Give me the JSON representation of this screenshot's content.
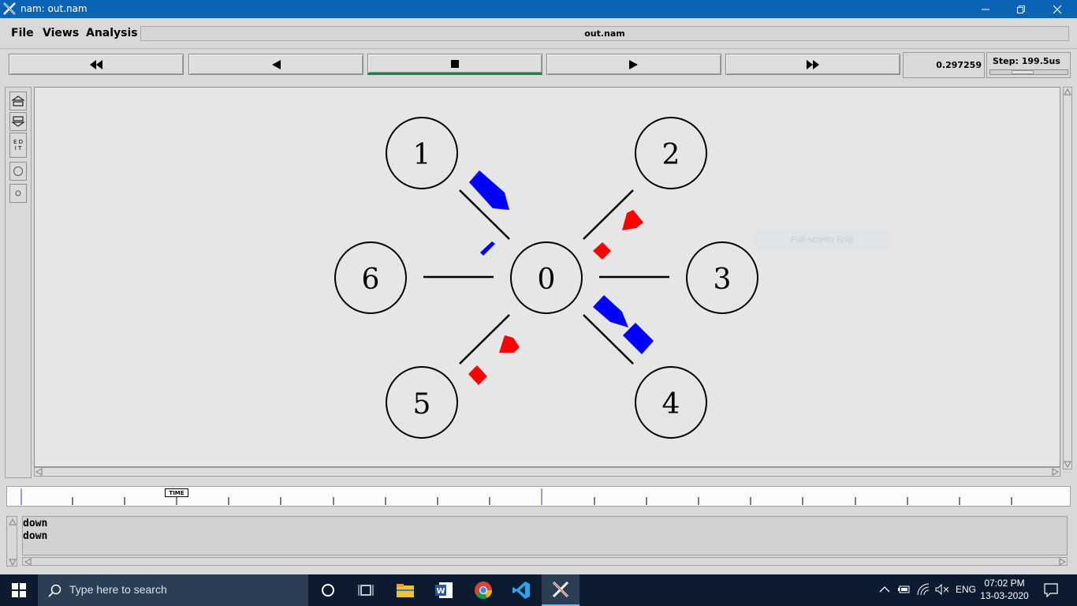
{
  "window": {
    "title": "nam: out.nam"
  },
  "menu": {
    "file": "File",
    "views": "Views",
    "analysis": "Analysis"
  },
  "filename": "out.nam",
  "controls": {
    "buttons": [
      "rewind",
      "step-back",
      "stop",
      "play",
      "fast-forward"
    ],
    "active": "stop"
  },
  "time": {
    "value": "0.297259",
    "step_label": "Step: 199.5us"
  },
  "tools": [
    "zoom-in-icon",
    "zoom-out-icon",
    "EDIT",
    "node-circle-icon",
    "small-node-icon"
  ],
  "topology": {
    "nodes": [
      {
        "id": "0",
        "label": "0"
      },
      {
        "id": "1",
        "label": "1"
      },
      {
        "id": "2",
        "label": "2"
      },
      {
        "id": "3",
        "label": "3"
      },
      {
        "id": "4",
        "label": "4"
      },
      {
        "id": "5",
        "label": "5"
      },
      {
        "id": "6",
        "label": "6"
      }
    ],
    "links": [
      [
        "0",
        "1"
      ],
      [
        "0",
        "2"
      ],
      [
        "0",
        "3"
      ],
      [
        "0",
        "4"
      ],
      [
        "0",
        "5"
      ],
      [
        "0",
        "6"
      ]
    ],
    "colors": {
      "packet_blue": "#0000ff",
      "packet_red": "#ff0000",
      "node_stroke": "#000000"
    }
  },
  "timeline": {
    "tag": "TIME"
  },
  "annotations": {
    "lines": [
      "down",
      "down"
    ]
  },
  "overlay": {
    "snip_hint": "Full-screen Snip"
  },
  "taskbar": {
    "search_placeholder": "Type here to search",
    "language": "ENG",
    "time": "07:02 PM",
    "date": "13-03-2020",
    "apps": [
      "task-view-icon",
      "file-explorer-icon",
      "word-icon",
      "chrome-icon",
      "vscode-icon",
      "nam-icon"
    ]
  }
}
